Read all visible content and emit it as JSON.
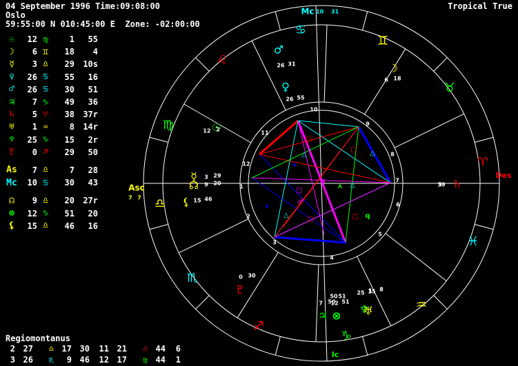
{
  "header": {
    "line1": "04 September 1996 Time:09:08:00",
    "line2": "Oslo",
    "line3": "59:55:00 N 010:45:00 E  Zone: -02:00:00",
    "mode": "Tropical True"
  },
  "colors": {
    "fire": "#ff0000",
    "earth": "#00ff00",
    "air": "#ffff00",
    "water": "#00ffff",
    "white": "#ffffff",
    "magenta": "#ff00ff",
    "blue": "#0000ff"
  },
  "planets": [
    {
      "glyph": "☉",
      "color": "#00ff00",
      "deg": "12",
      "sign": "♍",
      "scolor": "#00ff00",
      "min": "1",
      "sec": "55"
    },
    {
      "glyph": "☽",
      "color": "#ffff00",
      "deg": "6",
      "sign": "♊",
      "scolor": "#ffff00",
      "min": "18",
      "sec": "4"
    },
    {
      "glyph": "☿",
      "color": "#ffff00",
      "deg": "3",
      "sign": "♎",
      "scolor": "#ffff00",
      "min": "29",
      "sec": "10s"
    },
    {
      "glyph": "♀",
      "color": "#00ffff",
      "deg": "26",
      "sign": "♋",
      "scolor": "#00ffff",
      "min": "55",
      "sec": "16"
    },
    {
      "glyph": "♂",
      "color": "#00ffff",
      "deg": "26",
      "sign": "♋",
      "scolor": "#00ffff",
      "min": "30",
      "sec": "51"
    },
    {
      "glyph": "♃",
      "color": "#00ff00",
      "deg": "7",
      "sign": "♑",
      "scolor": "#00ff00",
      "min": "49",
      "sec": "36"
    },
    {
      "glyph": "♄",
      "color": "#ff0000",
      "deg": "5",
      "sign": "♈",
      "scolor": "#ff0000",
      "min": "38",
      "sec": "37r"
    },
    {
      "glyph": "♅",
      "color": "#ffff00",
      "deg": "1",
      "sign": "♒",
      "scolor": "#ffff00",
      "min": "8",
      "sec": "14r"
    },
    {
      "glyph": "♆",
      "color": "#00ff00",
      "deg": "25",
      "sign": "♑",
      "scolor": "#00ff00",
      "min": "15",
      "sec": "2r"
    },
    {
      "glyph": "♇",
      "color": "#ff0000",
      "deg": "0",
      "sign": "♐",
      "scolor": "#ff0000",
      "min": "29",
      "sec": "50"
    }
  ],
  "points": [
    {
      "glyph": "As",
      "color": "#ffff00",
      "deg": "7",
      "sign": "♎",
      "scolor": "#ffff00",
      "min": "7",
      "sec": "28"
    },
    {
      "glyph": "Mc",
      "color": "#00ffff",
      "deg": "10",
      "sign": "♋",
      "scolor": "#00ffff",
      "min": "30",
      "sec": "43"
    }
  ],
  "nodes": [
    {
      "glyph": "☊",
      "color": "#ffff00",
      "deg": "9",
      "sign": "♎",
      "scolor": "#ffff00",
      "min": "20",
      "sec": "27r"
    },
    {
      "glyph": "⊗",
      "color": "#00ff00",
      "deg": "12",
      "sign": "♑",
      "scolor": "#00ff00",
      "min": "51",
      "sec": "20"
    },
    {
      "glyph": "⚸",
      "color": "#ffff00",
      "deg": "15",
      "sign": "♎",
      "scolor": "#ffff00",
      "min": "46",
      "sec": "16"
    }
  ],
  "houses": {
    "system": "Regiomontanus",
    "rows": [
      {
        "h1": "2",
        "d1": "27",
        "s1": "♎",
        "c1": "#ffff00",
        "m1": "17",
        "h2": "30",
        "h3": "11",
        "d2": "21",
        "s2": "♌",
        "c2": "#ff0000",
        "m2": "44",
        "x": "6"
      },
      {
        "h1": "3",
        "d1": "26",
        "s1": "♏",
        "c1": "#00ffff",
        "m1": "9",
        "h2": "46",
        "h3": "12",
        "d2": "17",
        "s2": "♍",
        "c2": "#00ff00",
        "m2": "44",
        "x": "1"
      }
    ]
  },
  "wheel": {
    "axes": {
      "mc": "Mc",
      "mc_deg": "10",
      "mc_min": "31",
      "asc": "Asc",
      "asc_deg": "7",
      "asc_min": "7",
      "des": "Des",
      "ic": "Ic"
    },
    "des_deg": "39",
    "des_min": "5",
    "ic_deg": "50",
    "ic_min": "51",
    "house_numbers": [
      "1",
      "2",
      "3",
      "4",
      "5",
      "6",
      "7",
      "8",
      "9",
      "10",
      "11",
      "12"
    ],
    "signs": [
      {
        "g": "♋",
        "c": "#00ffff"
      },
      {
        "g": "♊",
        "c": "#ffff00"
      },
      {
        "g": "♌",
        "c": "#ff0000"
      },
      {
        "g": "♉",
        "c": "#00ff00"
      },
      {
        "g": "♍",
        "c": "#00ff00"
      },
      {
        "g": "♈",
        "c": "#ff0000"
      },
      {
        "g": "♎",
        "c": "#ffff00"
      },
      {
        "g": "♓",
        "c": "#00ffff"
      },
      {
        "g": "♏",
        "c": "#00ffff"
      },
      {
        "g": "♒",
        "c": "#ffff00"
      },
      {
        "g": "♐",
        "c": "#ff0000"
      },
      {
        "g": "♑",
        "c": "#00ff00"
      }
    ],
    "planet_labels": [
      {
        "g": "♂",
        "c": "#00ffff",
        "t": "26",
        "t2": "31"
      },
      {
        "g": "♀",
        "c": "#00ffff",
        "t": "26",
        "t2": "55"
      },
      {
        "g": "☽",
        "c": "#ffff00",
        "t": "6",
        "t2": "18"
      },
      {
        "g": "☉",
        "c": "#00ff00",
        "t": "12",
        "t2": "2"
      },
      {
        "g": "☿",
        "c": "#ffff00",
        "t": "3",
        "t2": "29"
      },
      {
        "g": "☊",
        "c": "#ffff00",
        "t": "9",
        "t2": "20"
      },
      {
        "g": "⚸",
        "c": "#ffff00",
        "t": "15",
        "t2": "46"
      },
      {
        "g": "♄",
        "c": "#ff0000",
        "t": "5",
        "t2": ""
      },
      {
        "g": "♇",
        "c": "#ff0000",
        "t": "0",
        "t2": "30"
      },
      {
        "g": "♃",
        "c": "#00ff00",
        "t": "7",
        "t2": "50"
      },
      {
        "g": "⊗",
        "c": "#00ff00",
        "t": "12",
        "t2": "51"
      },
      {
        "g": "♆",
        "c": "#00ff00",
        "t": "25",
        "t2": "15"
      },
      {
        "g": "♅",
        "c": "#ffff00",
        "t": "1",
        "t2": "8"
      }
    ]
  }
}
